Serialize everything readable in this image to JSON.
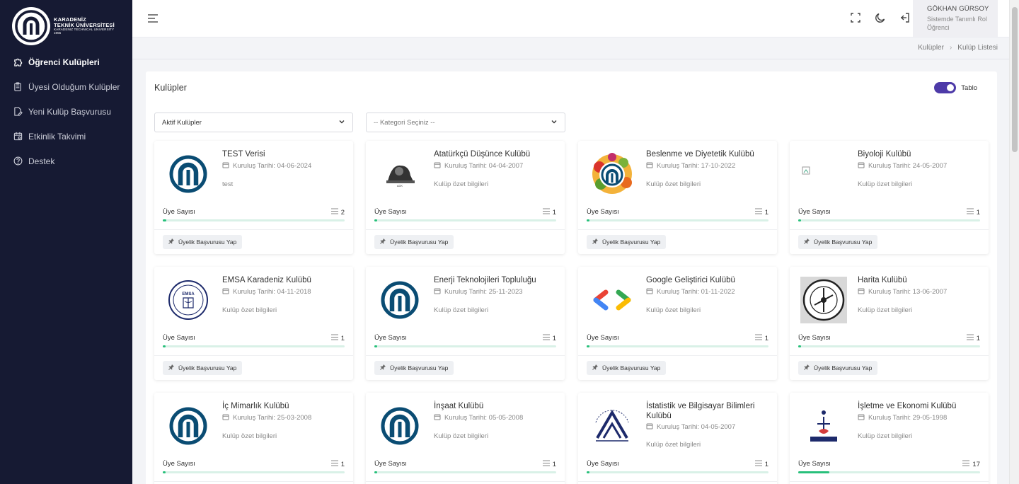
{
  "brand": {
    "line1": "KARADENİZ",
    "line2": "TEKNİK ÜNİVERSİTESİ",
    "line3": "KARADENIZ TECHNICAL UNIVERSITY",
    "line4": "1955"
  },
  "sidebar": {
    "items": [
      {
        "label": "Öğrenci Kulüpleri",
        "icon": "puzzle-icon"
      },
      {
        "label": "Üyesi Olduğum Kulüpler",
        "icon": "clipboard-icon"
      },
      {
        "label": "Yeni Kulüp Başvurusu",
        "icon": "file-edit-icon"
      },
      {
        "label": "Etkinlik Takvimi",
        "icon": "calendar-icon"
      },
      {
        "label": "Destek",
        "icon": "help-circle-icon"
      }
    ]
  },
  "user": {
    "name": "GÖKHAN GÜRSOY",
    "role_line1": "Sistemde Tanımlı Rol",
    "role_line2": "Öğrenci"
  },
  "breadcrumb": {
    "parent": "Kulüpler",
    "current": "Kulüp Listesi"
  },
  "panel": {
    "title": "Kulüpler",
    "toggle_label": "Tablo",
    "status_select": "Aktif Kulüpler",
    "category_select": "-- Kategori Seçiniz --"
  },
  "card_labels": {
    "date_prefix": "Kuruluş Tarihi:",
    "members": "Üye Sayısı",
    "apply_button": "Üyelik Başvurusu Yap"
  },
  "clubs": [
    {
      "name": "TEST Verisi",
      "date": "04-06-2024",
      "desc": "test",
      "members": "2",
      "fill": 0.02,
      "logo": "ktu-logo"
    },
    {
      "name": "Atatürkçü Düşünce Kulübü",
      "date": "04-04-2007",
      "desc": "Kulüp özet bilgileri",
      "members": "1",
      "fill": 0.01,
      "logo": "ataturk-logo"
    },
    {
      "name": "Beslenme ve Diyetetik Kulübü",
      "date": "17-10-2022",
      "desc": "Kulüp özet bilgileri",
      "members": "1",
      "fill": 0.01,
      "logo": "nutrition-logo"
    },
    {
      "name": "Biyoloji Kulübü",
      "date": "24-05-2007",
      "desc": "Kulüp özet bilgileri",
      "members": "1",
      "fill": 0.01,
      "logo": "broken-image"
    },
    {
      "name": "EMSA Karadeniz Kulübü",
      "date": "04-11-2018",
      "desc": "Kulüp özet bilgileri",
      "members": "1",
      "fill": 0.01,
      "logo": "emsa-logo"
    },
    {
      "name": "Enerji Teknolojileri Topluluğu",
      "date": "25-11-2023",
      "desc": "Kulüp özet bilgileri",
      "members": "1",
      "fill": 0.01,
      "logo": "ktu-logo"
    },
    {
      "name": "Google Geliştirici Kulübü",
      "date": "01-11-2022",
      "desc": "Kulüp özet bilgileri",
      "members": "1",
      "fill": 0.01,
      "logo": "gdg-logo"
    },
    {
      "name": "Harita Kulübü",
      "date": "13-06-2007",
      "desc": "Kulüp özet bilgileri",
      "members": "1",
      "fill": 0.01,
      "logo": "harita-logo"
    },
    {
      "name": "İç Mimarlık Kulübü",
      "date": "25-03-2008",
      "desc": "Kulüp özet bilgileri",
      "members": "1",
      "fill": 0.01,
      "logo": "ktu-logo"
    },
    {
      "name": "İnşaat Kulübü",
      "date": "05-05-2008",
      "desc": "Kulüp özet bilgileri",
      "members": "1",
      "fill": 0.01,
      "logo": "ktu-logo"
    },
    {
      "name": "İstatistik ve Bilgisayar Bilimleri Kulübü",
      "date": "04-05-2007",
      "desc": "Kulüp özet bilgileri",
      "members": "1",
      "fill": 0.01,
      "logo": "istatistik-logo"
    },
    {
      "name": "İşletme ve Ekonomi Kulübü",
      "date": "29-05-1998",
      "desc": "Kulüp özet bilgileri",
      "members": "17",
      "fill": 0.17,
      "logo": "isletme-logo"
    }
  ],
  "colors": {
    "sidebar_bg": "#161a33",
    "accent": "#4d3aa8",
    "progress": "#28c07b",
    "ktu_blue": "#0a4c73"
  }
}
